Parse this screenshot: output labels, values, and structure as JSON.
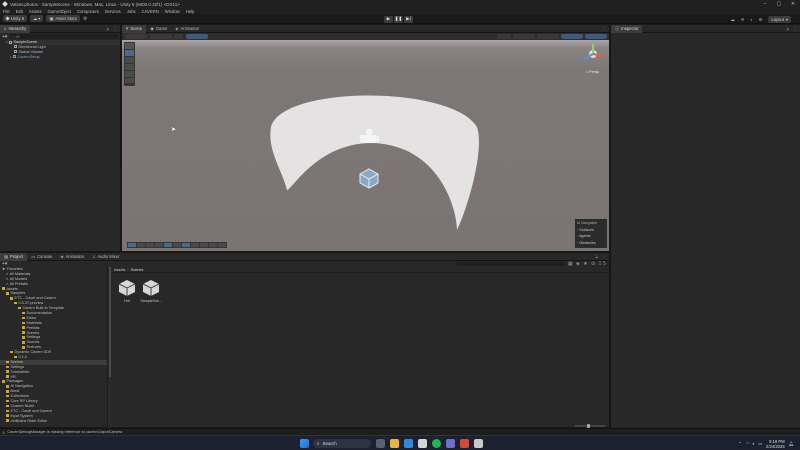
{
  "window": {
    "title": "Vatsev.photos - SampleScene - Windows, Mac, Linux - Unity 6 (6000.0.32f1) <DX11>",
    "controls": [
      "–",
      "▢",
      "✕"
    ]
  },
  "menu": [
    "File",
    "Edit",
    "Assets",
    "GameObject",
    "Component",
    "Services",
    "Jobs",
    "CAVERN",
    "Window",
    "Help"
  ],
  "toolbar": {
    "account": "Unity 6",
    "cloud": "",
    "asset_store": "Asset Store",
    "layout_label": "Layout"
  },
  "hierarchy": {
    "tab": "Hierarchy",
    "search_placeholder": "All",
    "items": [
      {
        "label": "SampleScene",
        "depth": 0
      },
      {
        "label": "Directional Light",
        "depth": 2
      },
      {
        "label": "Global Volume",
        "depth": 2
      },
      {
        "label": "CavernSetup",
        "depth": 1,
        "highlight": true
      }
    ]
  },
  "scene_tabs": [
    {
      "label": "Scene",
      "active": true
    },
    {
      "label": "Game",
      "active": false
    },
    {
      "label": "Animation",
      "active": false
    }
  ],
  "scene": {
    "persp_label": "< Persp",
    "overlay": [
      "AI Navigation",
      "Surfaces",
      "Agents",
      "Obstacles"
    ]
  },
  "inspector": {
    "tab": "Inspector"
  },
  "bottom_tabs": [
    {
      "label": "Project",
      "active": true
    },
    {
      "label": "Console",
      "active": false
    },
    {
      "label": "Animation",
      "active": false
    },
    {
      "label": "Audio Mixer",
      "active": false
    }
  ],
  "project_tree": [
    {
      "label": "Favorites",
      "depth": 0,
      "type": "star"
    },
    {
      "label": "All Materials",
      "depth": 1,
      "type": "search"
    },
    {
      "label": "All Models",
      "depth": 1,
      "type": "search"
    },
    {
      "label": "All Prefabs",
      "depth": 1,
      "type": "search"
    },
    {
      "label": "Assets",
      "depth": 0,
      "type": "folder"
    },
    {
      "label": "Samples",
      "depth": 1,
      "type": "folder"
    },
    {
      "label": "ETC - Cavel and Cavern",
      "depth": 2,
      "type": "folder"
    },
    {
      "label": "0.0.37-preview",
      "depth": 3,
      "type": "folder"
    },
    {
      "label": "Cavern Built-In Template",
      "depth": 4,
      "type": "folder"
    },
    {
      "label": "Documentation",
      "depth": 5,
      "type": "folder"
    },
    {
      "label": "Editor",
      "depth": 5,
      "type": "folder"
    },
    {
      "label": "Materials",
      "depth": 5,
      "type": "folder"
    },
    {
      "label": "Prefabs",
      "depth": 5,
      "type": "folder"
    },
    {
      "label": "Scenes",
      "depth": 5,
      "type": "folder"
    },
    {
      "label": "Settings",
      "depth": 5,
      "type": "folder"
    },
    {
      "label": "Sounds",
      "depth": 5,
      "type": "folder"
    },
    {
      "label": "Textures",
      "depth": 5,
      "type": "folder"
    },
    {
      "label": "Dynamic Cavern SDK",
      "depth": 2,
      "type": "folder"
    },
    {
      "label": "0.1.0",
      "depth": 3,
      "type": "folder"
    },
    {
      "label": "Scenes",
      "depth": 1,
      "type": "folder",
      "selected": true
    },
    {
      "label": "Settings",
      "depth": 1,
      "type": "folder"
    },
    {
      "label": "TutorialInfo",
      "depth": 1,
      "type": "folder"
    },
    {
      "label": "XR",
      "depth": 1,
      "type": "folder"
    },
    {
      "label": "Packages",
      "depth": 0,
      "type": "folder"
    },
    {
      "label": "AI Navigation",
      "depth": 1,
      "type": "folder"
    },
    {
      "label": "Burst",
      "depth": 1,
      "type": "folder"
    },
    {
      "label": "Collections",
      "depth": 1,
      "type": "folder"
    },
    {
      "label": "Core RP Library",
      "depth": 1,
      "type": "folder"
    },
    {
      "label": "Custom NUnit",
      "depth": 1,
      "type": "folder"
    },
    {
      "label": "ETC - Cavel and Cavern",
      "depth": 1,
      "type": "folder"
    },
    {
      "label": "Input System",
      "depth": 1,
      "type": "folder"
    },
    {
      "label": "JetBrains Rider Editor",
      "depth": 1,
      "type": "folder"
    }
  ],
  "breadcrumb": [
    "Assets",
    "Scenes"
  ],
  "assets": [
    {
      "label": "Hdr"
    },
    {
      "label": "SampleSce..."
    }
  ],
  "status": {
    "message": "CavernDebugManager is missing reference to cavernOutputCamera"
  },
  "taskbar": {
    "search_placeholder": "Search",
    "time": "5:18 PM",
    "date": "2/24/2025"
  },
  "colors": {
    "scene_bg": "#7d7776",
    "selection_blue": "#2c5d87",
    "warning_yellow": "#e1b33c",
    "folder": "#c9a54a"
  }
}
